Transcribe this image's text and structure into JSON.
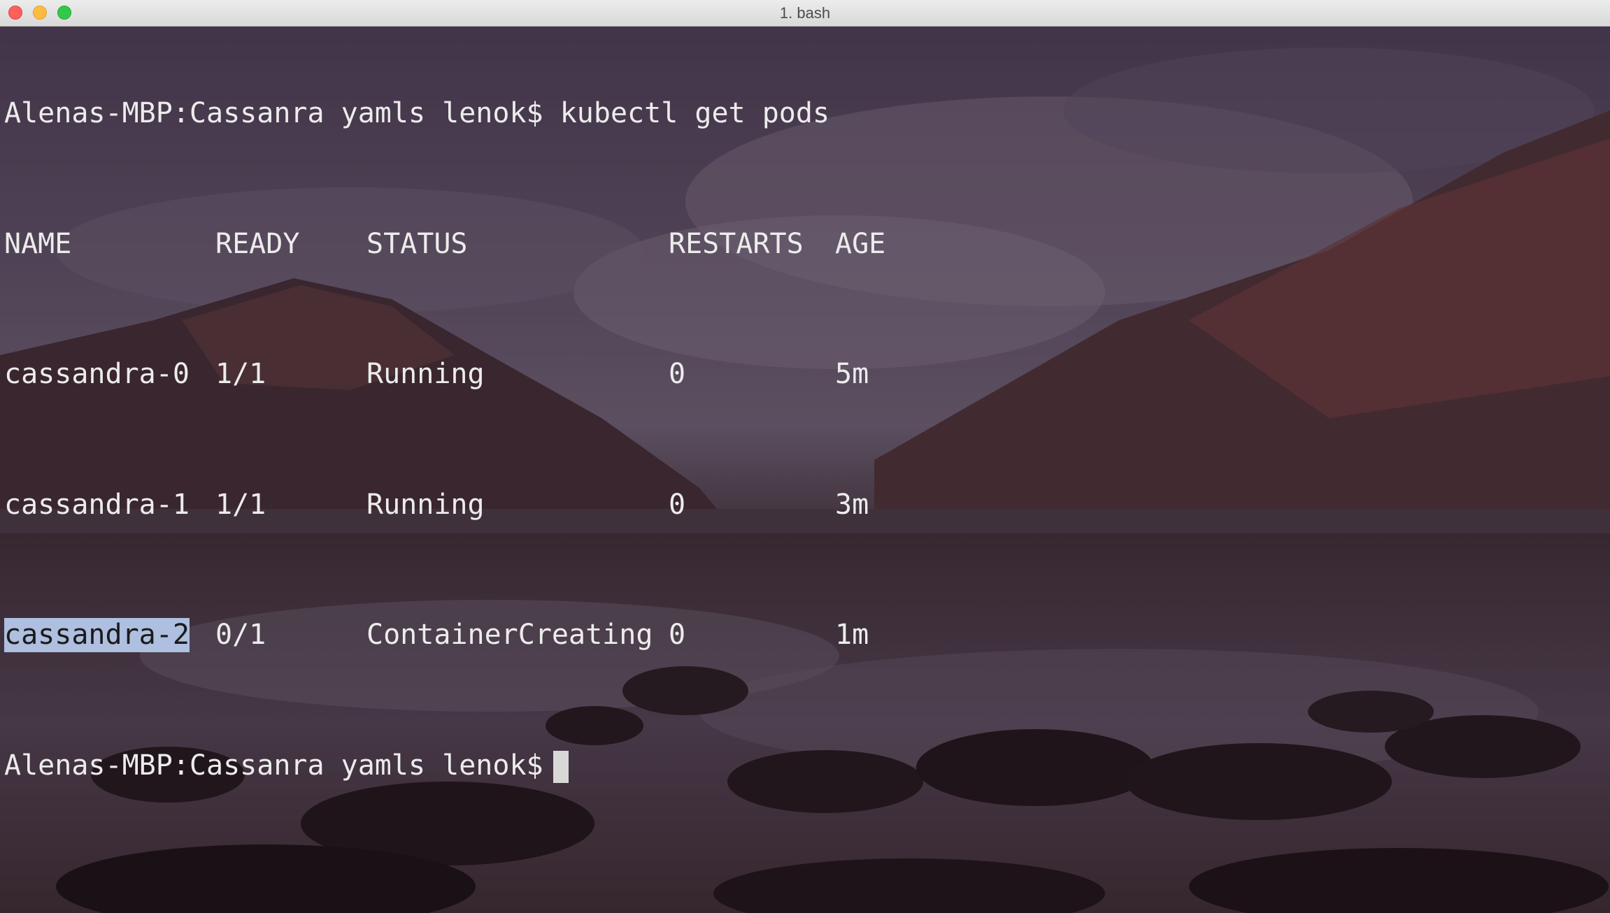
{
  "window": {
    "title": "1. bash"
  },
  "terminal": {
    "command_line": {
      "prompt": "Alenas-MBP:Cassanra yamls lenok$",
      "command": "kubectl get pods"
    },
    "table": {
      "headers": {
        "name": "NAME",
        "ready": "READY",
        "status": "STATUS",
        "restarts": "RESTARTS",
        "age": "AGE"
      },
      "rows": [
        {
          "name": "cassandra-0",
          "ready": "1/1",
          "status": "Running",
          "restarts": "0",
          "age": "5m"
        },
        {
          "name": "cassandra-1",
          "ready": "1/1",
          "status": "Running",
          "restarts": "0",
          "age": "3m"
        },
        {
          "name": "cassandra-2",
          "ready": "0/1",
          "status": "ContainerCreating",
          "restarts": "0",
          "age": "1m"
        }
      ]
    },
    "current_prompt": "Alenas-MBP:Cassanra yamls lenok$"
  },
  "colors": {
    "text": "#ececec",
    "selection": "#aebfe0"
  }
}
